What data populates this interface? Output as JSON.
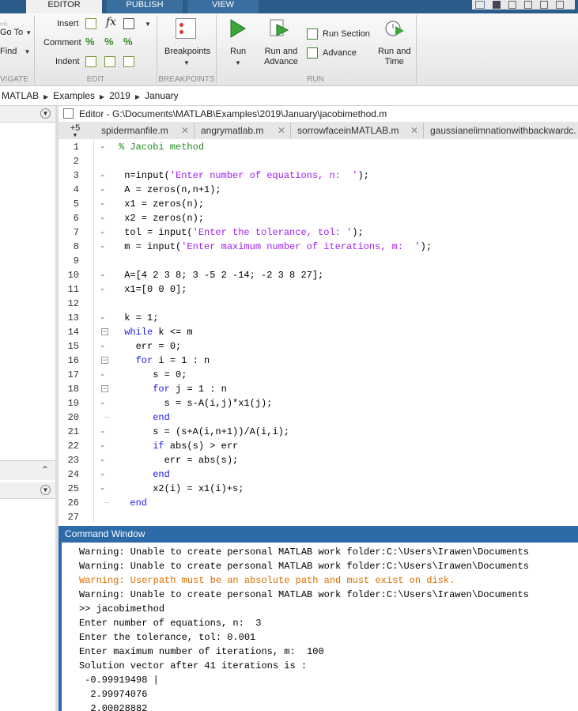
{
  "ribbon": {
    "tabs": [
      "EDITOR",
      "PUBLISH",
      "VIEW"
    ],
    "navigate": {
      "goto": "Go To",
      "find": "Find",
      "label": "VIGATE"
    },
    "edit": {
      "insert": "Insert",
      "comment": "Comment",
      "indent": "Indent",
      "fx": "fx",
      "label": "EDIT"
    },
    "breakpoints": {
      "button": "Breakpoints",
      "label": "BREAKPOINTS"
    },
    "run": {
      "run": "Run",
      "run_and_advance_1": "Run and",
      "run_and_advance_2": "Advance",
      "run_section": "Run Section",
      "advance": "Advance",
      "run_and_time_1": "Run and",
      "run_and_time_2": "Time",
      "label": "RUN"
    }
  },
  "breadcrumb": [
    "MATLAB",
    "Examples",
    "2019",
    "January"
  ],
  "editor": {
    "title": "Editor - G:\\Documents\\MATLAB\\Examples\\2019\\January\\jacobimethod.m",
    "more_tabs": "+5",
    "tabs": [
      "spidermanfile.m",
      "angrymatlab.m",
      "sorrowfaceinMATLAB.m",
      "gaussianelimnationwithbackwardc."
    ],
    "lines": [
      {
        "n": "1",
        "indent": "",
        "parts": [
          {
            "t": "% Jacobi method",
            "c": "cm"
          }
        ]
      },
      {
        "n": "2",
        "indent": "",
        "parts": []
      },
      {
        "n": "3",
        "indent": " ",
        "parts": [
          {
            "t": "n=input(",
            "c": ""
          },
          {
            "t": "'Enter number of equations, n:  '",
            "c": "str"
          },
          {
            "t": ");",
            "c": ""
          }
        ]
      },
      {
        "n": "4",
        "indent": " ",
        "parts": [
          {
            "t": "A = zeros(n,n+1);",
            "c": ""
          }
        ]
      },
      {
        "n": "5",
        "indent": " ",
        "parts": [
          {
            "t": "x1 = zeros(n);",
            "c": ""
          }
        ]
      },
      {
        "n": "6",
        "indent": " ",
        "parts": [
          {
            "t": "x2 = zeros(n);",
            "c": ""
          }
        ]
      },
      {
        "n": "7",
        "indent": " ",
        "parts": [
          {
            "t": "tol = input(",
            "c": ""
          },
          {
            "t": "'Enter the tolerance, tol: '",
            "c": "str"
          },
          {
            "t": ");",
            "c": ""
          }
        ]
      },
      {
        "n": "8",
        "indent": " ",
        "parts": [
          {
            "t": "m = input(",
            "c": ""
          },
          {
            "t": "'Enter maximum number of iterations, m:  '",
            "c": "str"
          },
          {
            "t": ");",
            "c": ""
          }
        ]
      },
      {
        "n": "9",
        "indent": "",
        "parts": []
      },
      {
        "n": "10",
        "indent": " ",
        "parts": [
          {
            "t": "A=[4 2 3 8; 3 -5 2 -14; -2 3 8 27];",
            "c": ""
          }
        ]
      },
      {
        "n": "11",
        "indent": " ",
        "parts": [
          {
            "t": "x1=[0 0 0];",
            "c": ""
          }
        ]
      },
      {
        "n": "12",
        "indent": "",
        "parts": []
      },
      {
        "n": "13",
        "indent": " ",
        "parts": [
          {
            "t": "k = 1;",
            "c": ""
          }
        ]
      },
      {
        "n": "14",
        "indent": " ",
        "parts": [
          {
            "t": "while",
            "c": "kw"
          },
          {
            "t": " k <= m",
            "c": ""
          }
        ]
      },
      {
        "n": "15",
        "indent": "   ",
        "parts": [
          {
            "t": "err = 0;",
            "c": ""
          }
        ]
      },
      {
        "n": "16",
        "indent": "   ",
        "parts": [
          {
            "t": "for",
            "c": "kw"
          },
          {
            "t": " i = 1 : n",
            "c": ""
          }
        ]
      },
      {
        "n": "17",
        "indent": "      ",
        "parts": [
          {
            "t": "s = 0;",
            "c": ""
          }
        ]
      },
      {
        "n": "18",
        "indent": "      ",
        "parts": [
          {
            "t": "for",
            "c": "kw"
          },
          {
            "t": " j = 1 : n",
            "c": ""
          }
        ]
      },
      {
        "n": "19",
        "indent": "        ",
        "parts": [
          {
            "t": "s = s-A(i,j)*x1(j);",
            "c": ""
          }
        ]
      },
      {
        "n": "20",
        "indent": "      ",
        "parts": [
          {
            "t": "end",
            "c": "kw"
          }
        ]
      },
      {
        "n": "21",
        "indent": "      ",
        "parts": [
          {
            "t": "s = (s+A(i,n+1))/A(i,i);",
            "c": ""
          }
        ]
      },
      {
        "n": "22",
        "indent": "      ",
        "parts": [
          {
            "t": "if",
            "c": "kw"
          },
          {
            "t": " abs(s) > err",
            "c": ""
          }
        ]
      },
      {
        "n": "23",
        "indent": "        ",
        "parts": [
          {
            "t": "err = abs(s);",
            "c": ""
          }
        ]
      },
      {
        "n": "24",
        "indent": "      ",
        "parts": [
          {
            "t": "end",
            "c": "kw"
          }
        ]
      },
      {
        "n": "25",
        "indent": "      ",
        "parts": [
          {
            "t": "x2(i) = x1(i)+s;",
            "c": ""
          }
        ]
      },
      {
        "n": "26",
        "indent": "  ",
        "parts": [
          {
            "t": "end",
            "c": "kw"
          }
        ]
      },
      {
        "n": "27",
        "indent": "",
        "parts": []
      }
    ]
  },
  "command_window": {
    "title": "Command Window",
    "lines": [
      {
        "t": "Warning: Unable to create personal MATLAB work folder:C:\\Users\\Irawen\\Documents",
        "c": ""
      },
      {
        "t": "Warning: Unable to create personal MATLAB work folder:C:\\Users\\Irawen\\Documents",
        "c": ""
      },
      {
        "t": "Warning: Userpath must be an absolute path and must exist on disk.",
        "c": "warn"
      },
      {
        "t": "Warning: Unable to create personal MATLAB work folder:C:\\Users\\Irawen\\Documents",
        "c": ""
      },
      {
        "t": ">> jacobimethod",
        "c": ""
      },
      {
        "t": "Enter number of equations, n:  3",
        "c": ""
      },
      {
        "t": "Enter the tolerance, tol: 0.001",
        "c": ""
      },
      {
        "t": "Enter maximum number of iterations, m:  100",
        "c": ""
      },
      {
        "t": "Solution vector after 41 iterations is :",
        "c": ""
      },
      {
        "t": " -0.99919498 |",
        "c": ""
      },
      {
        "t": "  2.99974076",
        "c": ""
      },
      {
        "t": "  2.00028882",
        "c": ""
      }
    ]
  },
  "colors": {
    "ribbon_tab_bar": "#2c5d8a",
    "command_title": "#2c6aa8",
    "keyword": "#1a1af0",
    "string": "#a020f0",
    "comment": "#228b22",
    "warning": "#e07000"
  }
}
